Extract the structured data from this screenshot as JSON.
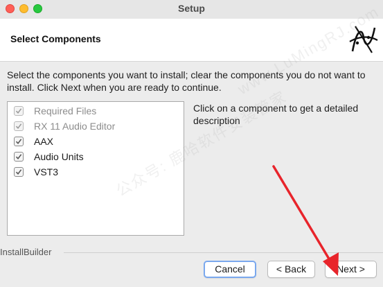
{
  "window": {
    "title": "Setup"
  },
  "header": {
    "title": "Select Components",
    "logo_icon": "bitrock-logo-icon"
  },
  "instructions": "Select the components you want to install; clear the components you do not want to install. Click Next when you are ready to continue.",
  "components": [
    {
      "label": "Required Files",
      "checked": true,
      "disabled": true
    },
    {
      "label": "RX 11 Audio Editor",
      "checked": true,
      "disabled": true
    },
    {
      "label": "AAX",
      "checked": true,
      "disabled": false
    },
    {
      "label": "Audio Units",
      "checked": true,
      "disabled": false
    },
    {
      "label": "VST3",
      "checked": true,
      "disabled": false
    }
  ],
  "description": "Click on a component to get a detailed description",
  "footer": {
    "brand": "InstallBuilder"
  },
  "buttons": {
    "cancel": "Cancel",
    "back": "< Back",
    "next": "Next >"
  },
  "watermark": {
    "text1": "www.LuMingRJ.com",
    "text2": "公众号: 鹿哈软件安装管家"
  },
  "colors": {
    "accent_focus": "#7aa8ee",
    "annotation_arrow": "#e8242b"
  }
}
